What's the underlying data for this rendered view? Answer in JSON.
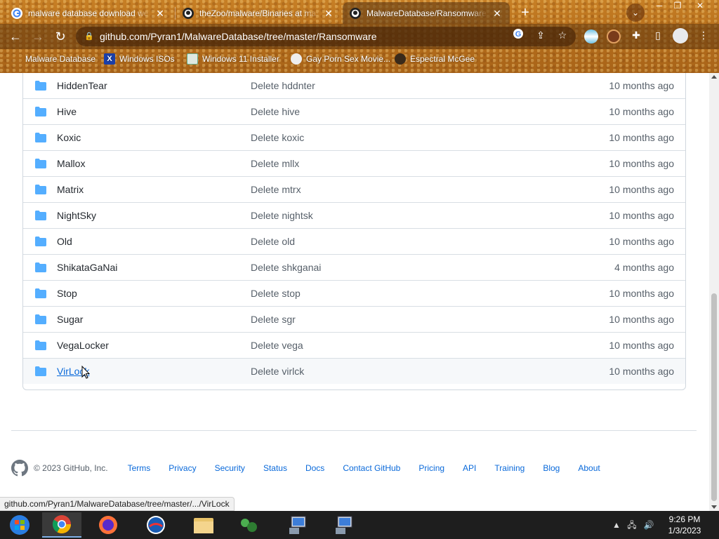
{
  "browser": {
    "tabs": [
      {
        "title": "malware database download website - Google",
        "active": false,
        "favicon": "google-icon"
      },
      {
        "title": "theZoo/malware/Binaries at master",
        "active": false,
        "favicon": "github-icon"
      },
      {
        "title": "MalwareDatabase/Ransomware at master",
        "active": true,
        "favicon": "github-icon"
      }
    ],
    "new_tab": "+",
    "url": "github.com/Pyran1/MalwareDatabase/tree/master/Ransomware",
    "bookmarks": [
      {
        "label": "Malware Database",
        "icon": "globe-icon"
      },
      {
        "label": "Windows ISOs",
        "icon": "x-icon"
      },
      {
        "label": "Windows 11 Installer",
        "icon": "image-icon"
      },
      {
        "label": "Gay Porn Sex Movie...",
        "icon": "site-icon"
      },
      {
        "label": "Espectral McGee",
        "icon": "avatar-icon"
      }
    ]
  },
  "files": [
    {
      "name": "HiddenTear",
      "message": "Delete hddnter",
      "age": "10 months ago"
    },
    {
      "name": "Hive",
      "message": "Delete hive",
      "age": "10 months ago"
    },
    {
      "name": "Koxic",
      "message": "Delete koxic",
      "age": "10 months ago"
    },
    {
      "name": "Mallox",
      "message": "Delete mllx",
      "age": "10 months ago"
    },
    {
      "name": "Matrix",
      "message": "Delete mtrx",
      "age": "10 months ago"
    },
    {
      "name": "NightSky",
      "message": "Delete nightsk",
      "age": "10 months ago"
    },
    {
      "name": "Old",
      "message": "Delete old",
      "age": "10 months ago"
    },
    {
      "name": "ShikataGaNai",
      "message": "Delete shkganai",
      "age": "4 months ago"
    },
    {
      "name": "Stop",
      "message": "Delete stop",
      "age": "10 months ago"
    },
    {
      "name": "Sugar",
      "message": "Delete sgr",
      "age": "10 months ago"
    },
    {
      "name": "VegaLocker",
      "message": "Delete vega",
      "age": "10 months ago"
    },
    {
      "name": "VirLock",
      "message": "Delete virlck",
      "age": "10 months ago"
    }
  ],
  "footer": {
    "copyright": "© 2023 GitHub, Inc.",
    "links": [
      "Terms",
      "Privacy",
      "Security",
      "Status",
      "Docs",
      "Contact GitHub",
      "Pricing",
      "API",
      "Training",
      "Blog",
      "About"
    ]
  },
  "status_url": "github.com/Pyran1/MalwareDatabase/tree/master/.../VirLock",
  "taskbar": {
    "time": "9:26 PM",
    "date": "1/3/2023"
  },
  "colors": {
    "link": "#0969da",
    "folder": "#54aeff",
    "text": "#24292f",
    "muted": "#57606a"
  }
}
